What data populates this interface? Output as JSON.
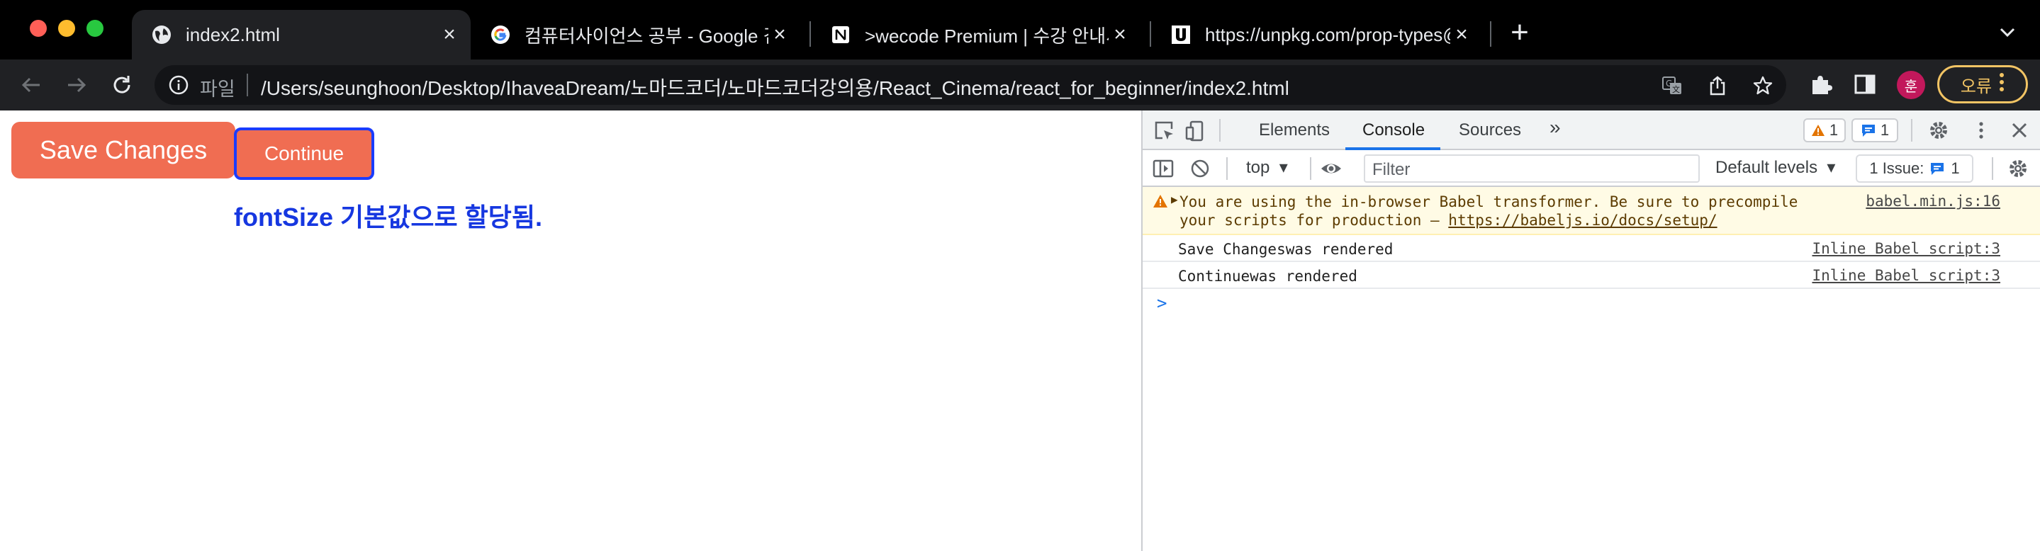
{
  "colors": {
    "tab_strip_bg": "#000000",
    "toolbar_bg": "#202124",
    "button_bg": "#f06d52",
    "focus_outline": "#1a3cff",
    "note_text": "#1637e0",
    "warning_bg": "#fffbe5",
    "devtools_accent": "#1a73e8",
    "error_chip": "#f2c464",
    "profile_bg": "#c2185b"
  },
  "browser": {
    "tabs": [
      {
        "title": "index2.html",
        "icon": "globe-icon",
        "active": true
      },
      {
        "title": "컴퓨터사이언스 공부 - Google 검색",
        "icon": "google-icon",
        "active": false
      },
      {
        "title": ">wecode Premium | 수강 안내서",
        "icon": "notion-icon",
        "active": false
      },
      {
        "title": "https://unpkg.com/prop-types@",
        "icon": "unpkg-icon",
        "active": false
      }
    ],
    "new_tab_label": "+",
    "address": {
      "scheme_label": "파일",
      "url": "/Users/seunghoon/Desktop/IhaveaDream/노마드코더/노마드코더강의용/React_Cinema/react_for_beginner/index2.html"
    },
    "profile_initial": "훈",
    "error_button_label": "오류"
  },
  "page": {
    "save_button_label": "Save Changes",
    "continue_button_label": "Continue",
    "note_text": "fontSize 기본값으로 할당됨."
  },
  "devtools": {
    "tabs": [
      "Elements",
      "Console",
      "Sources"
    ],
    "more_tabs_label": "»",
    "active_tab": "Console",
    "warning_count": "1",
    "message_count": "1",
    "context_label": "top",
    "filter_placeholder": "Filter",
    "levels_label": "Default levels",
    "issues_label": "1 Issue:",
    "issues_count": "1",
    "logs": [
      {
        "level": "warning",
        "message_line1": "You are using the in-browser Babel transformer. Be sure to precompile",
        "message_line2_prefix": "your scripts for production — ",
        "message_link": "https://babeljs.io/docs/setup/",
        "source": "babel.min.js:16"
      },
      {
        "level": "info",
        "message": "Save Changeswas rendered",
        "source": "Inline Babel script:3"
      },
      {
        "level": "info",
        "message": "Continuewas rendered",
        "source": "Inline Babel script:3"
      }
    ],
    "prompt_symbol": ">"
  }
}
